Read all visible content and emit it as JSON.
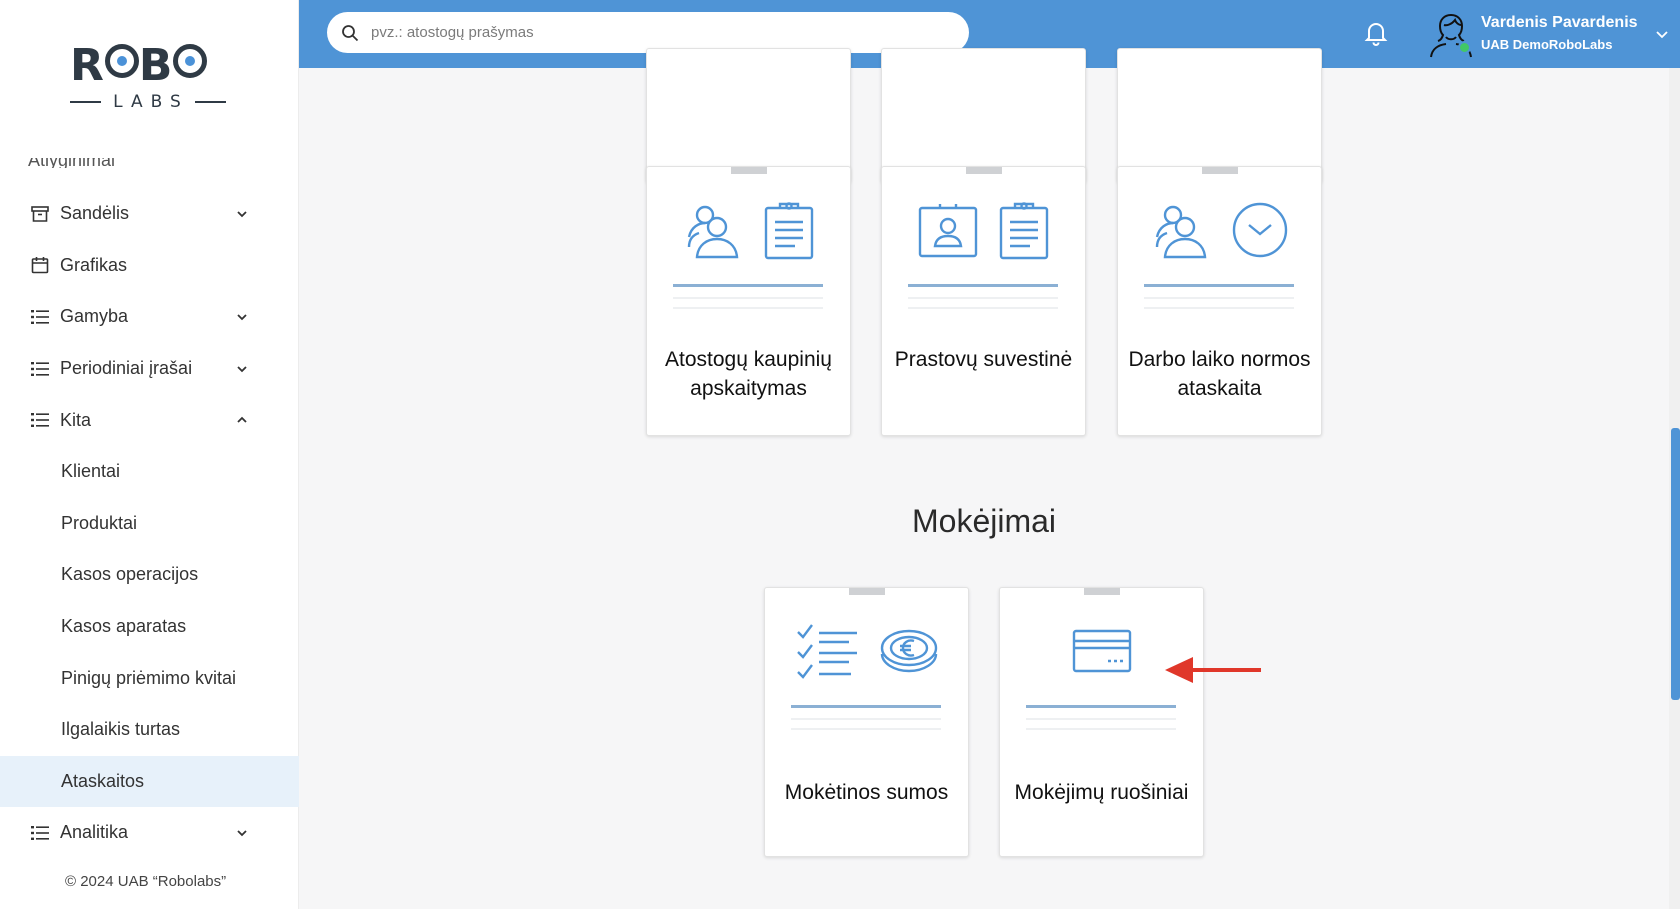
{
  "logo": {
    "top": "ROBO",
    "bottom": "LABS"
  },
  "sidebar": {
    "partial_item": "Atlyginimai",
    "items": [
      {
        "label": "Sandėlis",
        "icon": "archive-box-icon",
        "expandable": true,
        "expanded": false
      },
      {
        "label": "Grafikas",
        "icon": "calendar-icon",
        "expandable": false
      },
      {
        "label": "Gamyba",
        "icon": "list-icon",
        "expandable": true,
        "expanded": false
      },
      {
        "label": "Periodiniai įrašai",
        "icon": "list-icon",
        "expandable": true,
        "expanded": false
      },
      {
        "label": "Kita",
        "icon": "list-icon",
        "expandable": true,
        "expanded": true
      },
      {
        "label": "Analitika",
        "icon": "list-icon",
        "expandable": true,
        "expanded": false
      }
    ],
    "subitems": [
      {
        "label": "Klientai"
      },
      {
        "label": "Produktai"
      },
      {
        "label": "Kasos operacijos"
      },
      {
        "label": "Kasos aparatas"
      },
      {
        "label": "Pinigų priėmimo kvitai"
      },
      {
        "label": "Ilgalaikis turtas"
      },
      {
        "label": "Ataskaitos",
        "active": true
      }
    ],
    "copyright": "© 2024 UAB “Robolabs”"
  },
  "search": {
    "placeholder": "pvz.: atostogų prašymas",
    "value": ""
  },
  "user": {
    "name": "Vardenis Pavardenis",
    "company": "UAB DemoRoboLabs",
    "status_color": "#41c867"
  },
  "colors": {
    "accent": "#4f94d6",
    "annotation_arrow": "#e0372a"
  },
  "reports_row": [
    {
      "label": "Atostogų kaupinių apskaitymas",
      "icons": [
        "people-icon",
        "clipboard-icon"
      ]
    },
    {
      "label": "Prastovų suvestinė",
      "icons": [
        "id-card-icon",
        "clipboard-icon"
      ]
    },
    {
      "label": "Darbo laiko normos ataskaita",
      "icons": [
        "people-icon",
        "clock-icon"
      ]
    }
  ],
  "payments_section": {
    "title": "Mokėjimai",
    "cards": [
      {
        "label": "Mokėtinos sumos",
        "icons": [
          "checklist-icon",
          "euro-coins-icon"
        ]
      },
      {
        "label": "Mokėjimų ruošiniai",
        "icons": [
          "credit-card-icon"
        ]
      }
    ]
  }
}
